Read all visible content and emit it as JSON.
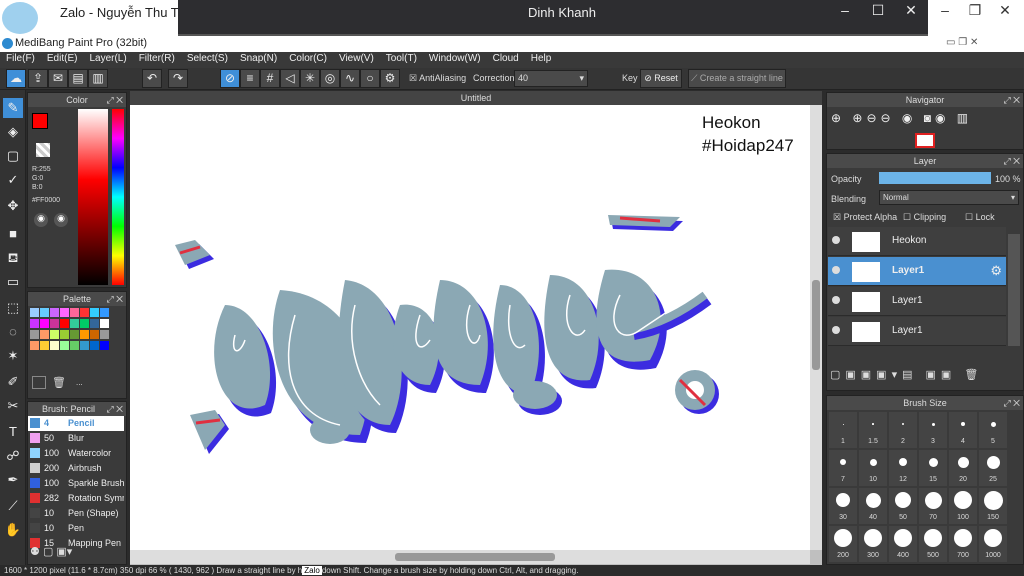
{
  "zalo": {
    "title": "Zalo - Nguyễn Thu Thả",
    "chat_title": "Dinh Khanh",
    "behind": "Nguyễn Thu Thảo"
  },
  "app": {
    "title": "MediBang Paint Pro (32bit)"
  },
  "menu": [
    "File(F)",
    "Edit(E)",
    "Layer(L)",
    "Filter(R)",
    "Select(S)",
    "Snap(N)",
    "Color(C)",
    "View(V)",
    "Tool(T)",
    "Window(W)",
    "Cloud",
    "Help"
  ],
  "toolbar": {
    "antialias": "AntiAliasing",
    "correction_label": "Correction",
    "correction_value": "40",
    "key_label": "Key",
    "reset": "Reset",
    "straight": "Create a straight line"
  },
  "color": {
    "title": "Color",
    "r": "R:255",
    "g": "G:0",
    "b": "B:0",
    "hex": "#FF0000",
    "fg": "#ff0000"
  },
  "palette": {
    "title": "Palette",
    "more": "..."
  },
  "brush": {
    "title": "Brush: Pencil",
    "items": [
      {
        "n": "4",
        "l": "Pencil",
        "c": "#4a90d0"
      },
      {
        "n": "50",
        "l": "Blur",
        "c": "#f0a0f0"
      },
      {
        "n": "100",
        "l": "Watercolor",
        "c": "#8fd4ff"
      },
      {
        "n": "200",
        "l": "Airbrush",
        "c": "#d0d0d0"
      },
      {
        "n": "100",
        "l": "Sparkle Brush",
        "c": "#3060e0"
      },
      {
        "n": "282",
        "l": "Rotation Symmetry",
        "c": "#e03030"
      },
      {
        "n": "10",
        "l": "Pen (Shape)",
        "c": "#444"
      },
      {
        "n": "10",
        "l": "Pen",
        "c": "#444"
      },
      {
        "n": "15",
        "l": "Mapping Pen",
        "c": "#e03030"
      }
    ]
  },
  "canvas": {
    "tab": "Untitled",
    "text1": "Heokon",
    "text2": "#Hoidap247"
  },
  "navigator": {
    "title": "Navigator"
  },
  "layer": {
    "title": "Layer",
    "opacity_label": "Opacity",
    "opacity_value": "100 %",
    "blending_label": "Blending",
    "blending_value": "Normal",
    "protect": "Protect Alpha",
    "clipping": "Clipping",
    "lock": "Lock",
    "rows": [
      "Heokon",
      "Layer1",
      "Layer1",
      "Layer1"
    ]
  },
  "brushsize": {
    "title": "Brush Size",
    "sizes": [
      "1",
      "1.5",
      "2",
      "3",
      "4",
      "5",
      "7",
      "10",
      "12",
      "15",
      "20",
      "25",
      "30",
      "40",
      "50",
      "70",
      "100",
      "150",
      "200",
      "300",
      "400",
      "500",
      "700",
      "1000"
    ]
  },
  "status": {
    "text": "1600 * 1200 pixel  (11.6 * 8.7cm)  350 dpi  66 %  ( 1430, 962 )  Draw a straight line by h",
    "tooltip": "Zalo",
    "text2": "down Shift. Change a brush size by holding down Ctrl, Alt, and dragging."
  }
}
